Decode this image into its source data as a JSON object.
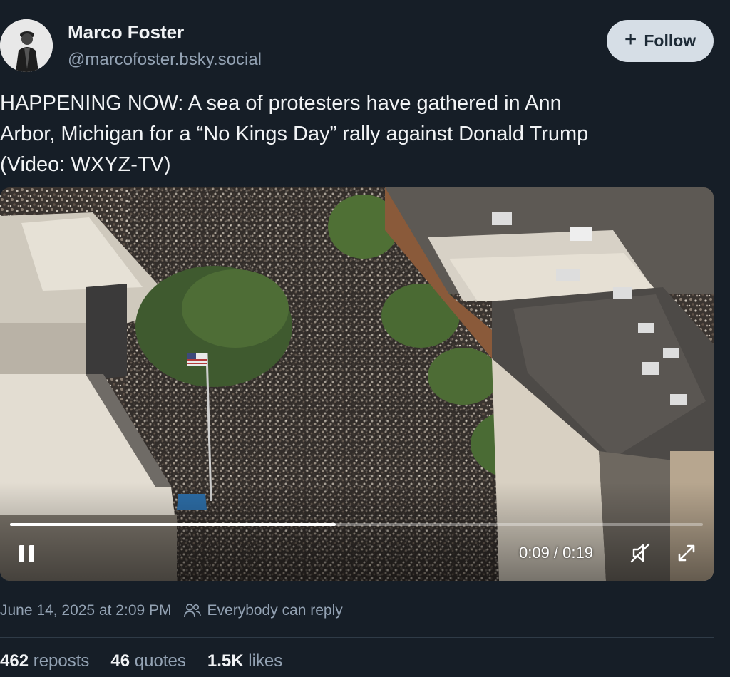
{
  "author": {
    "name": "Marco Foster",
    "handle": "@marcofoster.bsky.social"
  },
  "follow_button": {
    "plus": "+",
    "label": "Follow"
  },
  "post": {
    "lines": [
      "HAPPENING NOW: A sea of protesters have gathered in Ann",
      "Arbor, Michigan for a “No Kings Day” rally against Donald Trump",
      "(Video: WXYZ-TV)"
    ]
  },
  "video": {
    "time": "0:09 / 0:19",
    "progress_fraction": 0.47,
    "pause_icon": "pause-icon",
    "mute_icon": "muted-speaker-icon",
    "fullscreen_icon": "fullscreen-icon"
  },
  "meta": {
    "timestamp": "June 14, 2025 at 2:09 PM",
    "reply_setting": "Everybody can reply"
  },
  "stats": [
    {
      "count": "462",
      "label": "reposts"
    },
    {
      "count": "46",
      "label": "quotes"
    },
    {
      "count": "1.5K",
      "label": "likes"
    }
  ],
  "colors": {
    "background": "#161e27",
    "secondary_text": "#93a2b3",
    "follow_button_bg": "#d6dee6"
  }
}
